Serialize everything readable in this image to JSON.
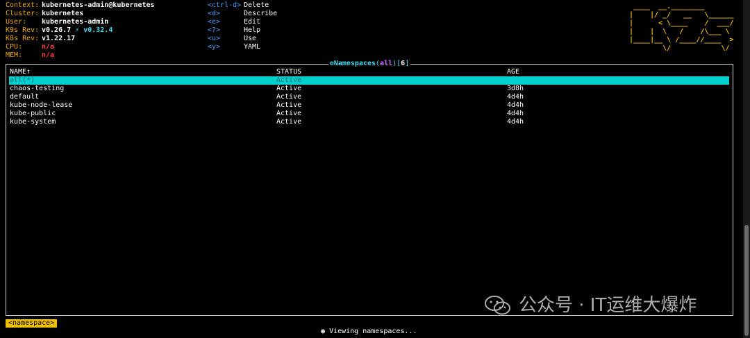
{
  "info": [
    {
      "key": "Context:",
      "value": "kubernetes-admin@kubernetes"
    },
    {
      "key": "Cluster:",
      "value": "kubernetes"
    },
    {
      "key": "User:",
      "value": "kubernetes-admin"
    },
    {
      "key": "K9s Rev:",
      "value": "v0.26.7",
      "extra": "⚡ v0.32.4"
    },
    {
      "key": "K8s Rev:",
      "value": "v1.22.17"
    },
    {
      "key": "CPU:",
      "value": "n/a"
    },
    {
      "key": "MEM:",
      "value": "n/a"
    }
  ],
  "menu": [
    {
      "key": "<ctrl-d>",
      "action": "Delete"
    },
    {
      "key": "<d>",
      "action": "Describe"
    },
    {
      "key": "<e>",
      "action": "Edit"
    },
    {
      "key": "<?>",
      "action": "Help"
    },
    {
      "key": "<u>",
      "action": "Use"
    },
    {
      "key": "<y>",
      "action": "YAML"
    }
  ],
  "logo_lines": [
    " ____  __.________       ",
    "|    |/ _/   __   \\______",
    "|      < \\____    /  ___/",
    "|    |  \\   /    /\\___ \\ ",
    "|____|__ \\ /____//____  >",
    "        \\/            \\/ "
  ],
  "panel": {
    "title_prefix": "Namespaces",
    "filter": "all",
    "count": "6",
    "columns": [
      "NAME↑",
      "STATUS",
      "AGE"
    ],
    "rows": [
      [
        "all(*)",
        "Active",
        ""
      ],
      [
        "chaos-testing",
        "Active",
        "3d8h"
      ],
      [
        "default",
        "Active",
        "4d4h"
      ],
      [
        "kube-node-lease",
        "Active",
        "4d4h"
      ],
      [
        "kube-public",
        "Active",
        "4d4h"
      ],
      [
        "kube-system",
        "Active",
        "4d4h"
      ]
    ]
  },
  "breadcrumb": "<namespace>",
  "status": "Viewing namespaces...",
  "watermark": "公众号 · IT运维大爆炸",
  "colors": {
    "accent": "#00cfd0",
    "label": "#f0a800",
    "key": "#4aa2ff",
    "logo": "#f0c000"
  }
}
